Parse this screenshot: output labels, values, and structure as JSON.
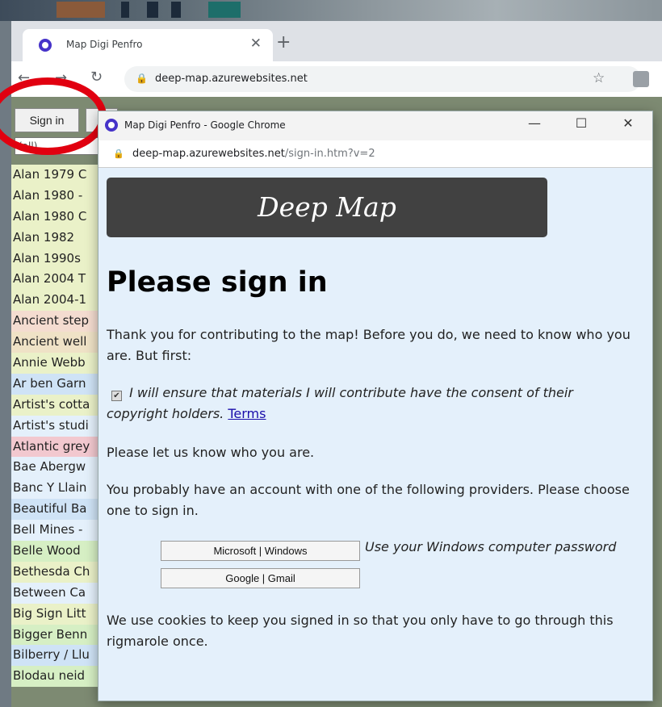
{
  "browser": {
    "tab_title": "Map Digi Penfro",
    "url": "deep-map.azurewebsites.net"
  },
  "page": {
    "sign_in_label": "Sign in",
    "filter_value": "(all)",
    "list_items": [
      {
        "label": "Alan 1979 C",
        "color": "#eaf1c8"
      },
      {
        "label": "Alan 1980 -",
        "color": "#eaf1c8"
      },
      {
        "label": "Alan 1980 C",
        "color": "#eaf1c8"
      },
      {
        "label": "Alan 1982",
        "color": "#eaf1c8"
      },
      {
        "label": "Alan 1990s",
        "color": "#eaf1c8"
      },
      {
        "label": "Alan 2004 T",
        "color": "#eaf1c8"
      },
      {
        "label": "Alan 2004-1",
        "color": "#eaf1c8"
      },
      {
        "label": "Ancient step",
        "color": "#f4dcd0"
      },
      {
        "label": "Ancient well",
        "color": "#efe2c6"
      },
      {
        "label": "Annie Webb",
        "color": "#eaf1c8"
      },
      {
        "label": "Ar ben Garn",
        "color": "#cfe3f6"
      },
      {
        "label": "Artist's cotta",
        "color": "#eaf1c8"
      },
      {
        "label": "Artist's studi",
        "color": "#e4f0fb"
      },
      {
        "label": "Atlantic grey",
        "color": "#f2c8cf"
      },
      {
        "label": "Bae Abergw",
        "color": "#e4f0fb"
      },
      {
        "label": "Banc Y Llain",
        "color": "#e4f0fb"
      },
      {
        "label": "Beautiful Ba",
        "color": "#cfe3f6"
      },
      {
        "label": "Bell Mines -",
        "color": "#e4f0fb"
      },
      {
        "label": "Belle Wood",
        "color": "#d6efc4"
      },
      {
        "label": "Bethesda Ch",
        "color": "#eaf1c8"
      },
      {
        "label": "Between Ca",
        "color": "#e4f0fb"
      },
      {
        "label": "Big Sign Litt",
        "color": "#eaf1c8"
      },
      {
        "label": "Bigger Benn",
        "color": "#d6efc4"
      },
      {
        "label": "Bilberry / Llu",
        "color": "#cfe3f6"
      },
      {
        "label": "Blodau neid",
        "color": "#d6efc4"
      }
    ]
  },
  "popup": {
    "window_title": "Map Digi Penfro - Google Chrome",
    "url_host": "deep-map.azurewebsites.net",
    "url_path": "/sign-in.htm?v=2",
    "banner": "Deep Map",
    "heading": "Please sign in",
    "intro": "Thank you for contributing to the map! Before you do, we need to know who you are. But first:",
    "consent_check": "✔",
    "consent_text": "I will ensure that materials I will contribute have the consent of their copyright holders.",
    "terms_label": "Terms",
    "identify": "Please let us know who you are.",
    "providers_intro": "You probably have an account with one of the following providers. Please choose one to sign in.",
    "microsoft_label": "Microsoft | Windows",
    "microsoft_hint": "Use your Windows computer password",
    "google_label": "Google | Gmail",
    "cookies": "We use cookies to keep you signed in so that you only have to go through this rigmarole once."
  },
  "icons": {
    "close": "✕",
    "minimize": "—",
    "maximize": "☐",
    "new_tab": "+",
    "back": "←",
    "forward": "→",
    "reload": "↻",
    "lock": "🔒",
    "star": "☆"
  },
  "colors": {
    "highlight_ring": "#e10010",
    "banner_bg": "#414141",
    "popup_bg": "#e4f0fb",
    "favicon": "#4633c9"
  }
}
